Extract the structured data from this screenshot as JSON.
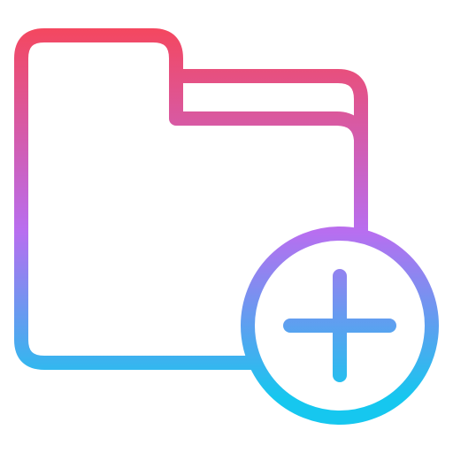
{
  "icon": {
    "name": "add-folder-icon",
    "gradient": {
      "top": "#f4475f",
      "mid": "#b86ef0",
      "bottom": "#16c7ef"
    },
    "background": "#ffffff"
  }
}
